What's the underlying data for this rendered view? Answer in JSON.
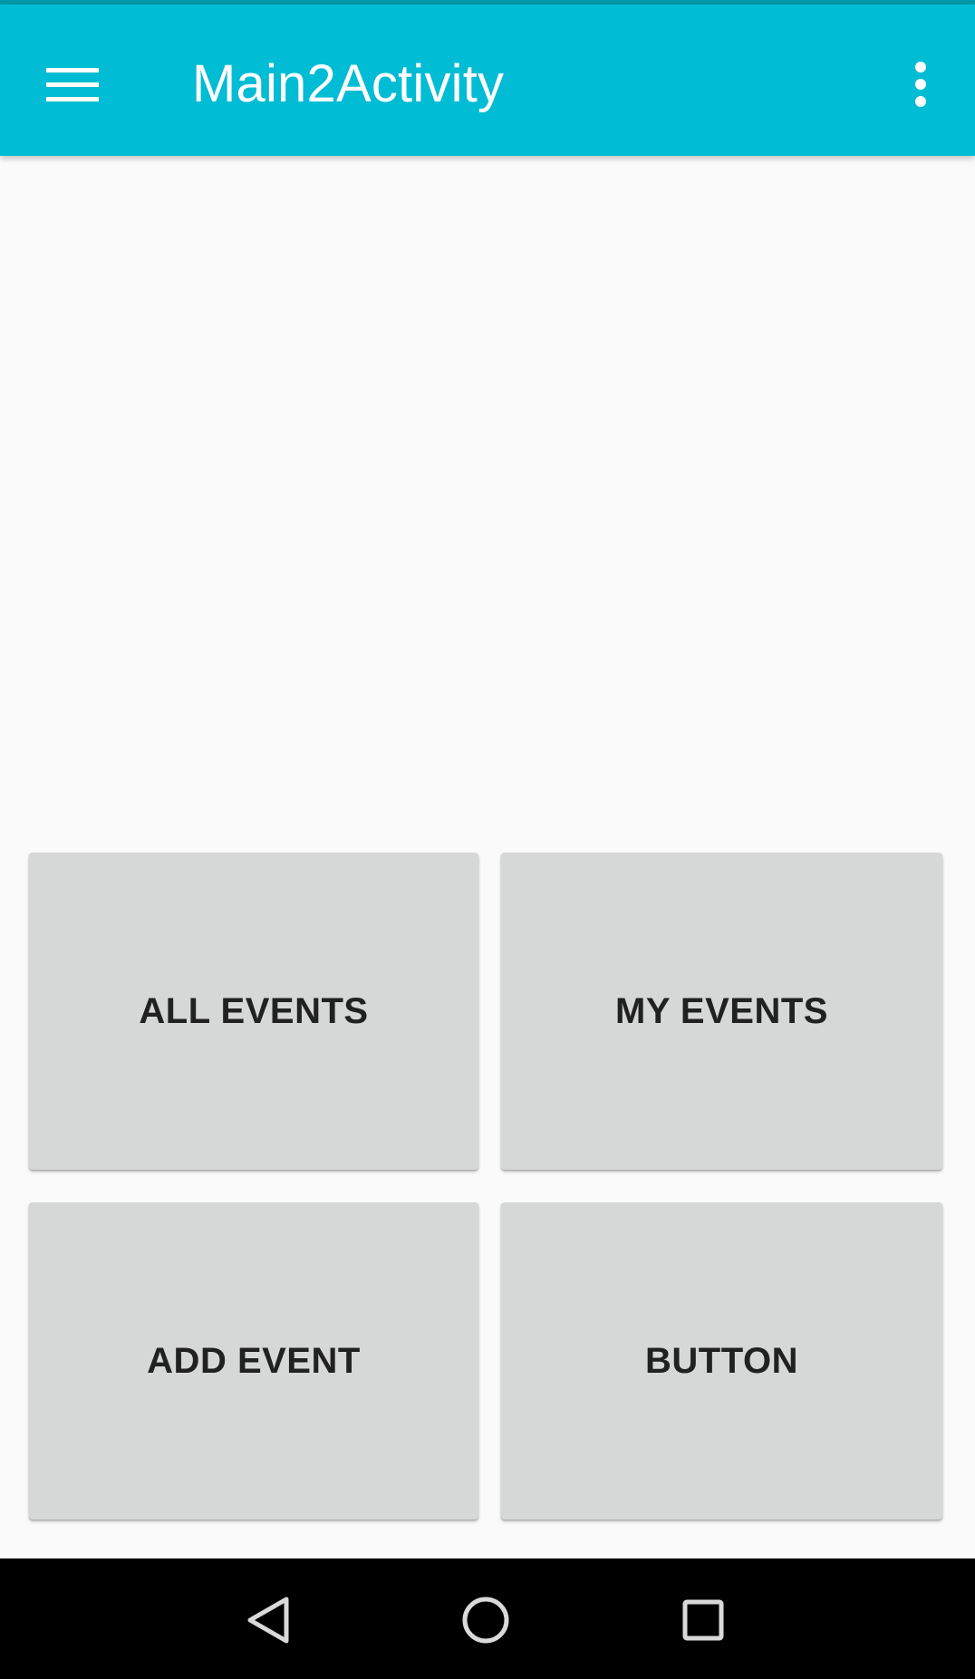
{
  "app_bar": {
    "title": "Main2Activity",
    "menu_icon": "hamburger-menu-icon",
    "overflow_icon": "more-vert-icon",
    "background_color": "#00bcd4"
  },
  "buttons": {
    "all_events": "ALL EVENTS",
    "my_events": "MY EVENTS",
    "add_event": "ADD EVENT",
    "generic": "BUTTON"
  },
  "navigation": {
    "back_icon": "back-triangle-icon",
    "home_icon": "home-circle-icon",
    "recents_icon": "recents-square-icon"
  }
}
